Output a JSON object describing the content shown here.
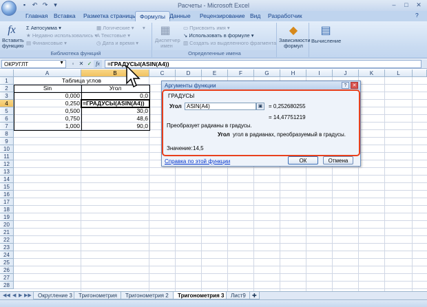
{
  "window": {
    "title": "Расчеты - Microsoft Excel"
  },
  "ribbon_tabs": [
    "Главная",
    "Вставка",
    "Разметка страницы",
    "Формулы",
    "Данные",
    "Рецензирование",
    "Вид",
    "Разработчик"
  ],
  "active_tab": "Формулы",
  "ribbon": {
    "insert_function": "Вставить функцию",
    "insert_fx": "fx",
    "autosum": "Автосумма",
    "recent": "Недавно использовались",
    "financial": "Финансовые",
    "logical": "Логические",
    "text": "Текстовые",
    "datetime": "Дата и время",
    "group1_caption": "Библиотека функций",
    "name_manager": "Диспетчер имен",
    "define_name": "Присвоить имя",
    "use_in_formula": "Использовать в формуле",
    "create_from_selection": "Создать из выделенного фрагмента",
    "group2_caption": "Определенные имена",
    "dependencies": "Зависимости формул",
    "calculation": "Вычисление"
  },
  "formula_bar": {
    "name_box": "ОКРУГЛТ",
    "formula": "=ГРАДУСЫ(ASIN(A4))",
    "fx": "fx"
  },
  "columns": [
    "A",
    "B",
    "C",
    "D",
    "E",
    "F",
    "G",
    "H",
    "I",
    "J",
    "K",
    "L"
  ],
  "rows": [
    "1",
    "2",
    "3",
    "4",
    "5",
    "6",
    "7",
    "8",
    "9",
    "10",
    "11",
    "12",
    "13",
    "14",
    "15",
    "16",
    "17",
    "18",
    "19",
    "20",
    "21",
    "22",
    "23",
    "24",
    "25",
    "26",
    "27",
    "28"
  ],
  "table": {
    "title": "Таблица углов",
    "header_a": "Sin",
    "header_b": "Угол",
    "rows": [
      {
        "a": "0,000",
        "b": "0,0"
      },
      {
        "a": "0,250",
        "b": "=ГРАДУСЫ(ASIN(A4))"
      },
      {
        "a": "0,500",
        "b": "30,0"
      },
      {
        "a": "0,750",
        "b": "48,6"
      },
      {
        "a": "1,000",
        "b": "90,0"
      }
    ]
  },
  "dialog": {
    "title": "Аргументы функции",
    "function_name": "ГРАДУСЫ",
    "arg_label": "Угол",
    "arg_value": "ASIN(A4)",
    "arg_result": "= 0,252680255",
    "result": "= 14,47751219",
    "description": "Преобразует радианы в градусы.",
    "arg_desc_label": "Угол",
    "arg_desc": "угол в радианах, преобразуемый в градусы.",
    "value_label": "Значение:",
    "value": "14,5",
    "help_link": "Справка по этой функции",
    "ok": "ОК",
    "cancel": "Отмена"
  },
  "sheet_tabs": [
    "Округление 3",
    "Тригонометрия",
    "Тригонометрия 2",
    "Тригонометрия 3",
    "Лист9"
  ],
  "active_sheet": "Тригонометрия 3",
  "colors": {
    "red_highlight": "#e8401c",
    "selected_header": "#f1c15f"
  }
}
